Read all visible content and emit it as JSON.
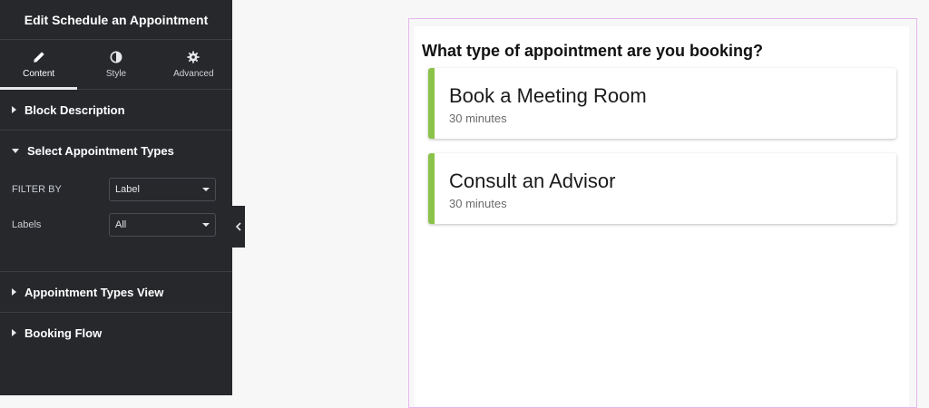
{
  "sidebar": {
    "title": "Edit Schedule an Appointment",
    "tabs": [
      {
        "label": "Content",
        "icon": "pencil-icon"
      },
      {
        "label": "Style",
        "icon": "contrast-icon"
      },
      {
        "label": "Advanced",
        "icon": "gear-icon"
      }
    ],
    "sections": {
      "block_description": "Block Description",
      "select_types": "Select Appointment Types",
      "types_view": "Appointment Types View",
      "booking_flow": "Booking Flow"
    },
    "fields": {
      "filter_by": {
        "label": "FILTER BY",
        "value": "Label"
      },
      "labels": {
        "label": "Labels",
        "value": "All"
      }
    }
  },
  "preview": {
    "question": "What type of appointment are you booking?",
    "cards": [
      {
        "title": "Book a Meeting Room",
        "duration": "30 minutes"
      },
      {
        "title": "Consult an Advisor",
        "duration": "30 minutes"
      }
    ]
  },
  "colors": {
    "sidebar_bg": "#26282c",
    "accent_green": "#8bc34a",
    "frame_border": "#e6b8ef"
  }
}
